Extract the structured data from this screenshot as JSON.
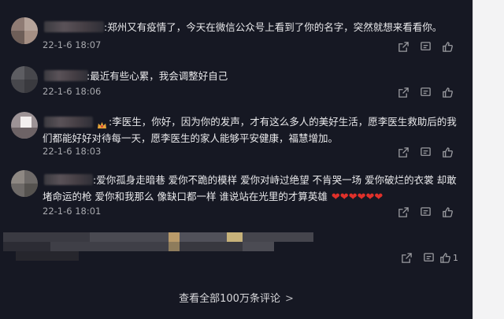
{
  "comments": [
    {
      "text": ":郑州又有疫情了，今天在微信公众号上看到了你的名字，突然就想来看看你。",
      "time": "22-1-6 18:07"
    },
    {
      "text": ":最近有些心累，我会调整好自己",
      "time": "22-1-6 18:06"
    },
    {
      "text": ":李医生，你好，因为你的发声，才有这么多人的美好生活，愿李医生救助后的我们都能好好对待每一天，愿李医生的家人能够平安健康，福慧增加。",
      "time": "22-1-6 18:03"
    },
    {
      "text": ":爱你孤身走暗巷 爱你不跪的模样 爱你对峙过绝望 不肯哭一场 爱你破烂的衣裳 却敢堵命运的枪 爱你和我那么 像缺口都一样 谁说站在光里的才算英雄",
      "hearts": "❤❤❤❤❤❤",
      "time": "22-1-6 18:01"
    },
    {
      "like_count": "1"
    }
  ],
  "footer": {
    "view_all_label": "查看全部100万条评论",
    "chevron": ">"
  },
  "icons": {
    "share": "share-icon",
    "message": "message-icon",
    "like": "thumbs-up-icon"
  },
  "colors": {
    "panel_bg": "#161823",
    "heart": "#e0302a"
  }
}
